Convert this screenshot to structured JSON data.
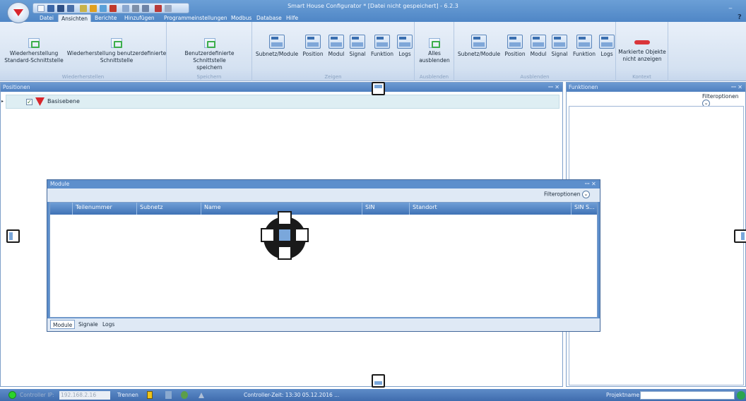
{
  "window": {
    "title": "Smart House Configurator * [Datei nicht gespeichert] - 6.2.3",
    "minimize": "_ ",
    "help": "?"
  },
  "tabs": [
    {
      "label": "Datei"
    },
    {
      "label": "Ansichten",
      "active": true
    },
    {
      "label": "Berichte"
    },
    {
      "label": "Hinzufügen"
    },
    {
      "label": "Programmeinstellungen"
    },
    {
      "label": "Modbus"
    },
    {
      "label": "Database"
    },
    {
      "label": "Hilfe"
    }
  ],
  "ribbon": {
    "groups": {
      "wiederherstellen": "Wiederherstellen",
      "speichern": "Speichern",
      "zeigen": "Zeigen",
      "ausblenden1": "Ausblenden",
      "ausblenden2": "Ausblenden",
      "kontext": "Kontext"
    },
    "buttons": {
      "restore_std_1": "Wiederherstellung",
      "restore_std_2": "Standard-Schnittstelle",
      "restore_user_1": "Wiederherstellung benutzerdefinierte",
      "restore_user_2": "Schnittstelle",
      "save_user_1": "Benutzerdefinierte Schnittstelle",
      "save_user_2": "speichern",
      "show_subnet": "Subnetz/Module",
      "show_position": "Position",
      "show_modul": "Modul",
      "show_signal": "Signal",
      "show_funktion": "Funktion",
      "show_logs": "Logs",
      "hide_all_1": "Alles",
      "hide_all_2": "ausblenden",
      "hide_subnet": "Subnetz/Module",
      "hide_position": "Position",
      "hide_modul": "Modul",
      "hide_signal": "Signal",
      "hide_funktion": "Funktion",
      "hide_logs": "Logs",
      "hide_marked_1": "Markierte Objekte",
      "hide_marked_2": "nicht anzeigen"
    }
  },
  "positions_panel": {
    "title": "Positionen",
    "controls": "ꟷ ✕",
    "tree_root": "Basisebene",
    "tree_check": "✓"
  },
  "funktionen_panel": {
    "title": "Funktionen",
    "controls": "ꟷ ✕",
    "filter": "Filteroptionen"
  },
  "module_window": {
    "title": "Module",
    "controls": "ꟷ ✕",
    "filter": "Filteroptionen",
    "columns": [
      "Teilenummer",
      "Subnetz",
      "Name",
      "SIN",
      "Standort",
      "SIN S..."
    ],
    "tabs": [
      "Module",
      "Signale",
      "Logs"
    ]
  },
  "statusbar": {
    "controller_ip_label": "Controller IP:",
    "controller_ip": "192.168.2.16",
    "disconnect": "Trennen",
    "controller_time": "Controller-Zeit: 13:30  05.12.2016 ...",
    "project_label": "Projektname:"
  }
}
